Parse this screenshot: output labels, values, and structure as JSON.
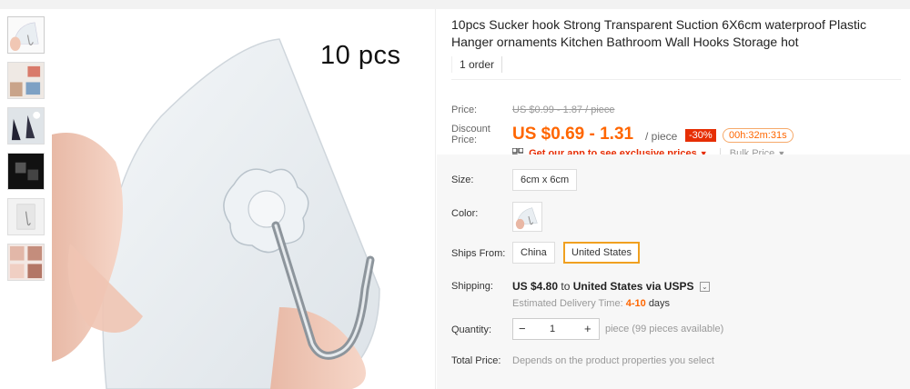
{
  "gallery": {
    "caption": "10 pcs",
    "thumbnails": [
      "main",
      "room",
      "bathroom",
      "black",
      "single",
      "detail"
    ]
  },
  "product": {
    "title": "10pcs Sucker hook Strong Transparent Suction 6X6cm waterproof Plastic Hanger ornaments Kitchen Bathroom Wall Hooks Storage hot",
    "orders": "1 order"
  },
  "pricing": {
    "price_label": "Price:",
    "old_price": "US $0.99 - 1.87 / piece",
    "discount_label_1": "Discount",
    "discount_label_2": "Price:",
    "new_price": "US $0.69 - 1.31",
    "unit": "/ piece",
    "discount_badge": "-30%",
    "timer": "00h:32m:31s",
    "app_promo": "Get our app to see exclusive prices",
    "bulk_price": "Bulk Price"
  },
  "options": {
    "size_label": "Size:",
    "size_value": "6cm x 6cm",
    "color_label": "Color:",
    "ships_from_label": "Ships From:",
    "ships_from_options": [
      "China",
      "United States"
    ],
    "ships_from_selected": "United States"
  },
  "shipping": {
    "label": "Shipping:",
    "cost": "US $4.80",
    "to": "to",
    "destination": "United States via USPS",
    "eta_prefix": "Estimated Delivery Time:",
    "eta_days": "4-10",
    "eta_suffix": "days"
  },
  "quantity": {
    "label": "Quantity:",
    "value": "1",
    "hint": "piece (99 pieces available)"
  },
  "total": {
    "label": "Total Price:",
    "value": "Depends on the product properties you select"
  },
  "colors": {
    "price": "#ff6600",
    "badge": "#e62e04",
    "selected_border": "#f0a020",
    "panel_bg": "#f7f7f7"
  }
}
